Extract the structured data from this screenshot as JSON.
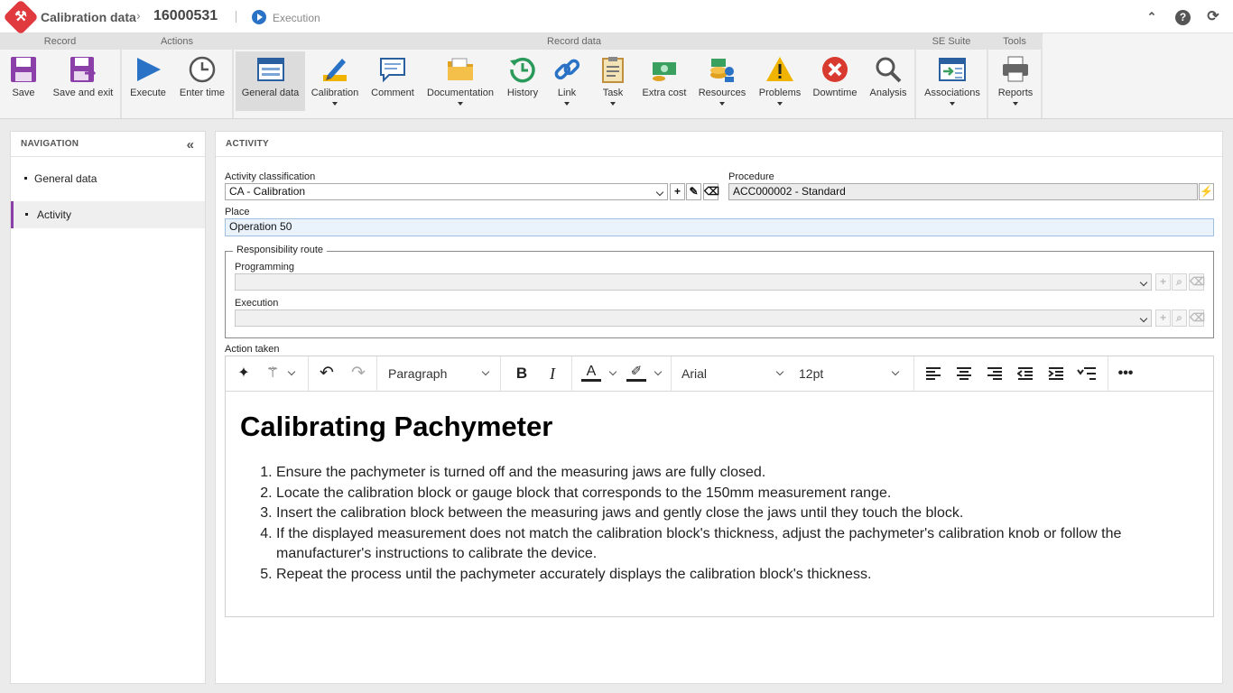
{
  "header": {
    "module_title": "Calibration data",
    "record_id": "16000531",
    "status": "Execution"
  },
  "ribbon": {
    "groups": {
      "record": "Record",
      "actions": "Actions",
      "record_data": "Record data",
      "se_suite": "SE Suite",
      "tools": "Tools"
    },
    "buttons": {
      "save": "Save",
      "save_exit": "Save and exit",
      "execute": "Execute",
      "enter_time": "Enter time",
      "general_data": "General data",
      "calibration": "Calibration",
      "comment": "Comment",
      "documentation": "Documentation",
      "history": "History",
      "link": "Link",
      "task": "Task",
      "extra_cost": "Extra cost",
      "resources": "Resources",
      "problems": "Problems",
      "downtime": "Downtime",
      "analysis": "Analysis",
      "associations": "Associations",
      "reports": "Reports"
    }
  },
  "navigation": {
    "title": "NAVIGATION",
    "items": [
      "General data",
      "Activity"
    ]
  },
  "activity": {
    "title": "ACTIVITY",
    "classification_label": "Activity classification",
    "classification_value": "CA - Calibration",
    "procedure_label": "Procedure",
    "procedure_value": "ACC000002 - Standard",
    "place_label": "Place",
    "place_value": "Operation 50",
    "route_legend": "Responsibility route",
    "programming_label": "Programming",
    "execution_label": "Execution",
    "action_taken_label": "Action taken"
  },
  "editor": {
    "block_format": "Paragraph",
    "font_family": "Arial",
    "font_size": "12pt",
    "heading": "Calibrating Pachymeter",
    "steps": [
      "Ensure the pachymeter is turned off and the measuring jaws are fully closed.",
      "Locate the calibration block or gauge block that corresponds to the 150mm measurement range.",
      "Insert the calibration block between the measuring jaws and gently close the jaws until they touch the block.",
      "If the displayed measurement does not match the calibration block's thickness, adjust the pachymeter's calibration knob or follow the manufacturer's instructions to calibrate the device.",
      "Repeat the process until the pachymeter accurately displays the calibration block's thickness."
    ]
  },
  "colors": {
    "accent_purple": "#8b3fa8",
    "brand_red": "#e0393e",
    "status_blue": "#2a72c6"
  }
}
